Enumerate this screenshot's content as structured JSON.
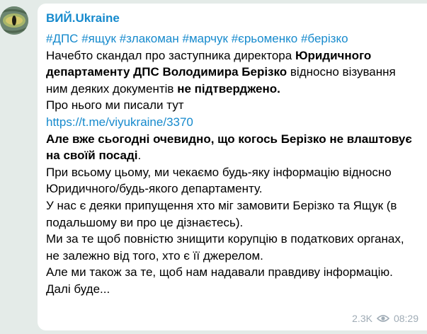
{
  "channel": {
    "name": "ВИЙ.Ukraine"
  },
  "message": {
    "hashtags": [
      "#ДПС",
      "#ящук",
      "#злакоман",
      "#марчук",
      "#єрьоменко",
      "#берізко"
    ],
    "p1": {
      "t1": "Начебто скандал про заступника директора ",
      "b1": "Юридичного департаменту ДПС Володимира Берізко",
      "t2": " відносно візування ним деяких  документів ",
      "b2": "не підтверджено.",
      "t3": ""
    },
    "p2": "Про нього ми писали тут",
    "link": "https://t.me/viyukraine/3370",
    "p3": {
      "b1": "Але вже сьогодні очевидно, що когось Берізко  не влаштовує на своїй посаді",
      "t1": "."
    },
    "p4": "При всьому цьому, ми чекаємо будь-яку інформацію відносно Юридичного/будь-якого департаменту.",
    "p5": "У нас є деяки припущення хто міг замовити Берізко та Ящук (в подальшому ви про це дізнаєтесь).",
    "p6": "Ми за те щоб повністю знищити корупцію в податкових органах, не залежно від того, хто є її джерелом.",
    "p7": "Але ми також  за те, щоб нам надавали правдиву інформацію.",
    "p8": "Далі буде..."
  },
  "meta": {
    "views": "2.3K",
    "time": "08:29",
    "views_icon": "eye-icon"
  },
  "colors": {
    "background": "#e4ebe8",
    "bubble": "#ffffff",
    "accent": "#168acd",
    "meta": "#a0acb6"
  }
}
